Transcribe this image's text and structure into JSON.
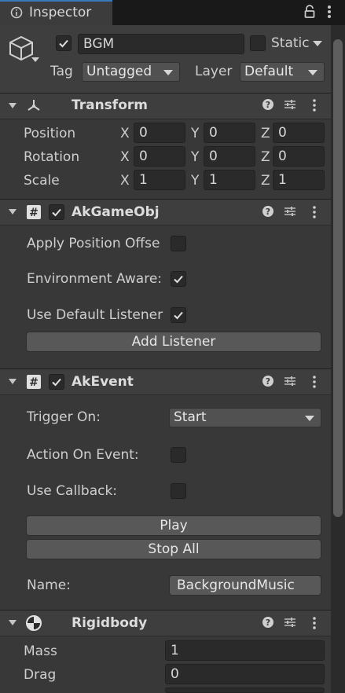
{
  "tab": {
    "title": "Inspector"
  },
  "gameobject": {
    "name": "BGM",
    "active": true,
    "static_label": "Static",
    "static": false,
    "tag_label": "Tag",
    "tag_value": "Untagged",
    "layer_label": "Layer",
    "layer_value": "Default"
  },
  "transform": {
    "title": "Transform",
    "rows": [
      {
        "label": "Position",
        "x": "0",
        "y": "0",
        "z": "0"
      },
      {
        "label": "Rotation",
        "x": "0",
        "y": "0",
        "z": "0"
      },
      {
        "label": "Scale",
        "x": "1",
        "y": "1",
        "z": "1"
      }
    ],
    "axes": {
      "x": "X",
      "y": "Y",
      "z": "Z"
    }
  },
  "akgameobj": {
    "title": "AkGameObj",
    "enabled": true,
    "apply_position_label": "Apply Position Offse",
    "apply_position": false,
    "environment_aware_label": "Environment Aware:",
    "environment_aware": true,
    "use_default_listener_label": "Use Default Listener",
    "use_default_listener": true,
    "add_listener_label": "Add Listener"
  },
  "akevent": {
    "title": "AkEvent",
    "enabled": true,
    "trigger_on_label": "Trigger On:",
    "trigger_on_value": "Start",
    "action_on_event_label": "Action On Event:",
    "action_on_event": false,
    "use_callback_label": "Use Callback:",
    "use_callback": false,
    "play_label": "Play",
    "stop_all_label": "Stop All",
    "name_label": "Name:",
    "name_value": "BackgroundMusic"
  },
  "rigidbody": {
    "title": "Rigidbody",
    "mass_label": "Mass",
    "mass_value": "1",
    "drag_label": "Drag",
    "drag_value": "0"
  },
  "icons": {
    "tab": "inspector-icon",
    "lock": "lock-icon",
    "menu": "kebab-menu-icon",
    "gameobject": "cube-icon",
    "transform": "transform-icon",
    "script": "script-icon",
    "rigidbody": "rigidbody-icon",
    "help": "help-icon",
    "presets": "presets-icon"
  },
  "colors": {
    "panel": "#383838",
    "header": "#3e3e3e",
    "field": "#2a2a2a",
    "button": "#585858",
    "accent": "#3a79bb"
  }
}
